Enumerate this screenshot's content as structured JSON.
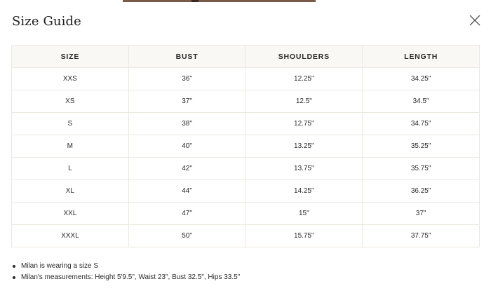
{
  "modal": {
    "title": "Size Guide",
    "close_icon": "close-icon"
  },
  "table": {
    "headers": [
      "SIZE",
      "BUST",
      "SHOULDERS",
      "LENGTH"
    ],
    "rows": [
      [
        "XXS",
        "36\"",
        "12.25\"",
        "34.25\""
      ],
      [
        "XS",
        "37\"",
        "12.5\"",
        "34.5\""
      ],
      [
        "S",
        "38\"",
        "12.75\"",
        "34.75\""
      ],
      [
        "M",
        "40\"",
        "13.25\"",
        "35.25\""
      ],
      [
        "L",
        "42\"",
        "13.75\"",
        "35.75\""
      ],
      [
        "XL",
        "44\"",
        "14.25\"",
        "36.25\""
      ],
      [
        "XXL",
        "47\"",
        "15\"",
        "37\""
      ],
      [
        "XXXL",
        "50\"",
        "15.75\"",
        "37.75\""
      ]
    ]
  },
  "notes": [
    "Milan is wearing a size S",
    "Milan's measurements: Height 5'9.5\", Waist 23\", Bust 32.5\", Hips 33.5\""
  ]
}
